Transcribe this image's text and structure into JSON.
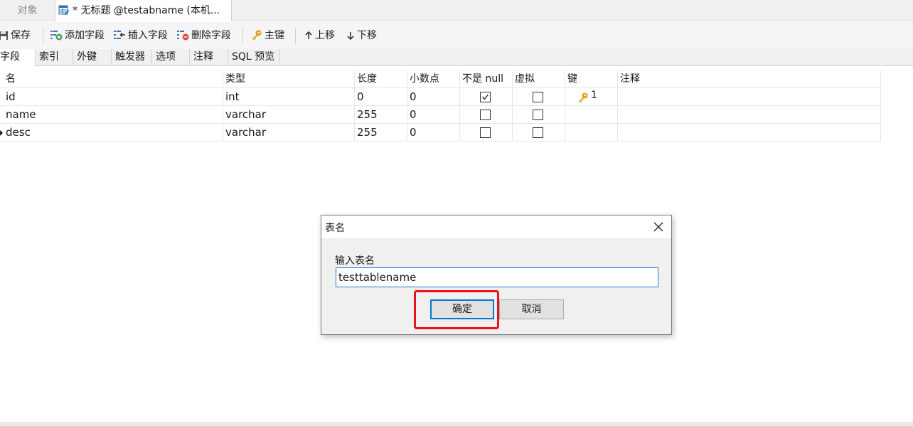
{
  "tabs": {
    "objects_label": "对象",
    "active_label": "* 无标题 @testabname (本机..."
  },
  "toolbar": {
    "save_label": "保存",
    "add_field_label": "添加字段",
    "insert_field_label": "插入字段",
    "delete_field_label": "删除字段",
    "primary_key_label": "主键",
    "move_up_label": "上移",
    "move_down_label": "下移"
  },
  "subtabs": [
    "字段",
    "索引",
    "外键",
    "触发器",
    "选项",
    "注释",
    "SQL 预览"
  ],
  "grid": {
    "columns": [
      "名",
      "类型",
      "长度",
      "小数点",
      "不是 null",
      "虚拟",
      "键",
      "注释"
    ],
    "rows": [
      {
        "name": "id",
        "type": "int",
        "length": "0",
        "decimals": "0",
        "not_null": true,
        "virtual": false,
        "key": "1",
        "comment": ""
      },
      {
        "name": "name",
        "type": "varchar",
        "length": "255",
        "decimals": "0",
        "not_null": false,
        "virtual": false,
        "key": "",
        "comment": ""
      },
      {
        "name": "desc",
        "type": "varchar",
        "length": "255",
        "decimals": "0",
        "not_null": false,
        "virtual": false,
        "key": "",
        "comment": ""
      }
    ]
  },
  "dialog": {
    "title": "表名",
    "prompt": "输入表名",
    "input_value": "testtablename",
    "ok_label": "确定",
    "cancel_label": "取消"
  },
  "colors": {
    "highlight": "#e8141a",
    "focus_blue": "#0078d7",
    "key_gold": "#e0a21b"
  }
}
